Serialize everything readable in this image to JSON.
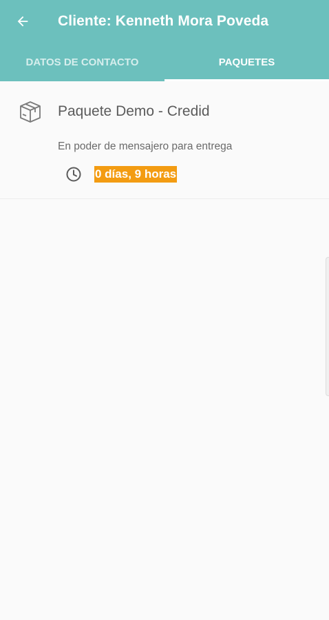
{
  "appbar": {
    "title": "Cliente: Kenneth Mora Poveda",
    "back_icon": "arrow-left-icon",
    "color": "#6cc0bd"
  },
  "tabs": [
    {
      "label": "DATOS DE CONTACTO",
      "active": false
    },
    {
      "label": "PAQUETES",
      "active": true
    }
  ],
  "packages": [
    {
      "icon": "package-box-icon",
      "name": "Paquete Demo - Credid",
      "status": "En poder de mensajero para entrega",
      "time_icon": "clock-icon",
      "elapsed": "0 días, 9 horas",
      "elapsed_color": "#f39c12"
    }
  ]
}
